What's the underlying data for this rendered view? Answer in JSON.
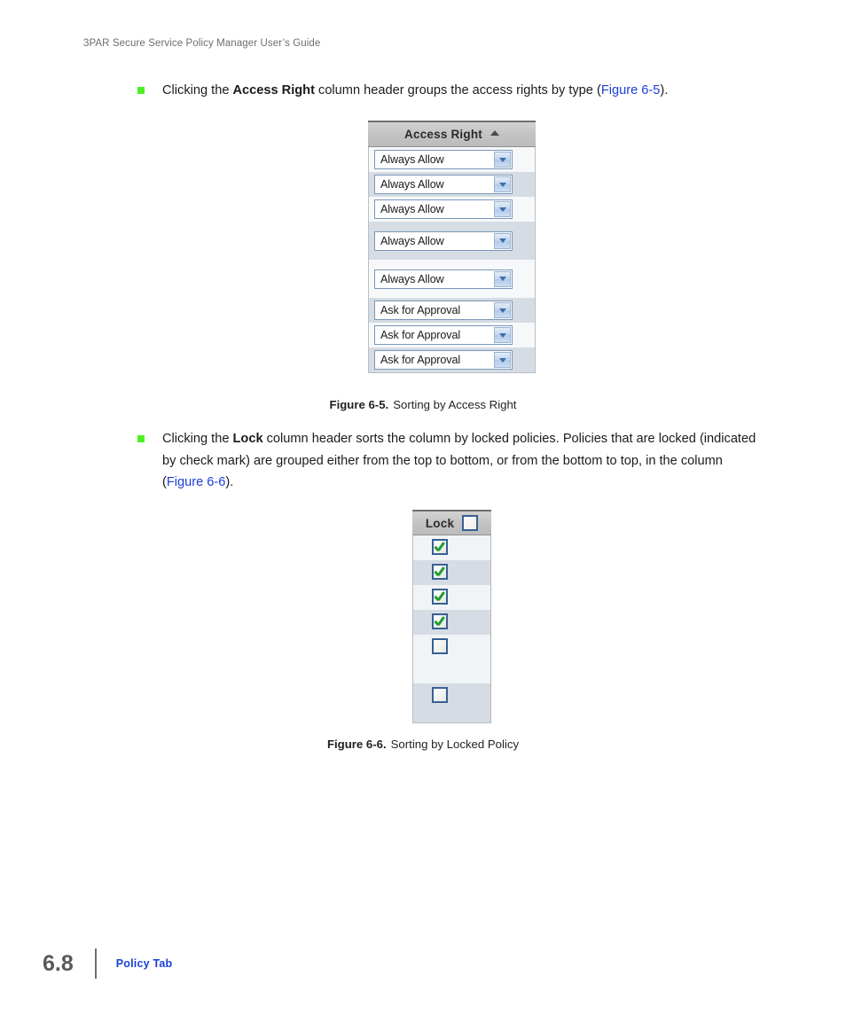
{
  "page": {
    "running_head": "3PAR Secure Service Policy Manager User’s Guide",
    "folio_number": "6.8",
    "footer_title": "Policy Tab"
  },
  "bullets": [
    {
      "id": "bullet-access-right",
      "pre": "Clicking the ",
      "bold": "Access Right",
      "mid": " column header groups the access rights by type (",
      "xref": "Figure 6-5",
      "post": ")."
    },
    {
      "id": "bullet-lock",
      "pre": "Clicking the ",
      "bold": "Lock",
      "mid": " column header sorts the column by locked policies. Policies that are locked (indicated by check mark) are grouped either from the top to bottom, or from the bottom to top, in the column (",
      "xref": "Figure 6-6",
      "post": ")."
    }
  ],
  "figures": [
    {
      "id": "figure-6-5",
      "caption_number": "Figure 6-5.",
      "caption_text": "Sorting by Access Right",
      "column_header": "Access Right",
      "sort_indicator": "sort-ascending-icon",
      "rows": [
        {
          "value": "Always Allow",
          "band": "white",
          "height": "h28"
        },
        {
          "value": "Always Allow",
          "band": "gray",
          "height": "h28"
        },
        {
          "value": "Always Allow",
          "band": "white",
          "height": "h28"
        },
        {
          "value": "Always Allow",
          "band": "gray",
          "height": "h43"
        },
        {
          "value": "Always Allow",
          "band": "white",
          "height": "h43"
        },
        {
          "value": "Ask for Approval",
          "band": "gray",
          "height": "h28"
        },
        {
          "value": "Ask for Approval",
          "band": "white",
          "height": "h28"
        },
        {
          "value": "Ask for Approval",
          "band": "gray",
          "height": "h28"
        }
      ]
    },
    {
      "id": "figure-6-6",
      "caption_number": "Figure 6-6.",
      "caption_text": "Sorting by Locked Policy",
      "column_header": "Lock",
      "header_checkbox_checked": false,
      "rows": [
        {
          "checked": true,
          "band": "white",
          "height": "h28"
        },
        {
          "checked": true,
          "band": "gray",
          "height": "h28"
        },
        {
          "checked": true,
          "band": "white",
          "height": "h28"
        },
        {
          "checked": true,
          "band": "gray",
          "height": "h28"
        },
        {
          "checked": false,
          "band": "white",
          "height": "h55"
        },
        {
          "checked": false,
          "band": "gray",
          "height": "h44"
        }
      ]
    }
  ],
  "colors": {
    "bullet_marker": "#4cf022",
    "cross_reference": "#1a3fd4",
    "header_band": "#c2c2c2",
    "row_gray": "#d5dce3",
    "row_white": "#f6f8fa",
    "checkbox_border": "#376092",
    "check_green": "#1f9e2e",
    "folio": "#58595b"
  }
}
